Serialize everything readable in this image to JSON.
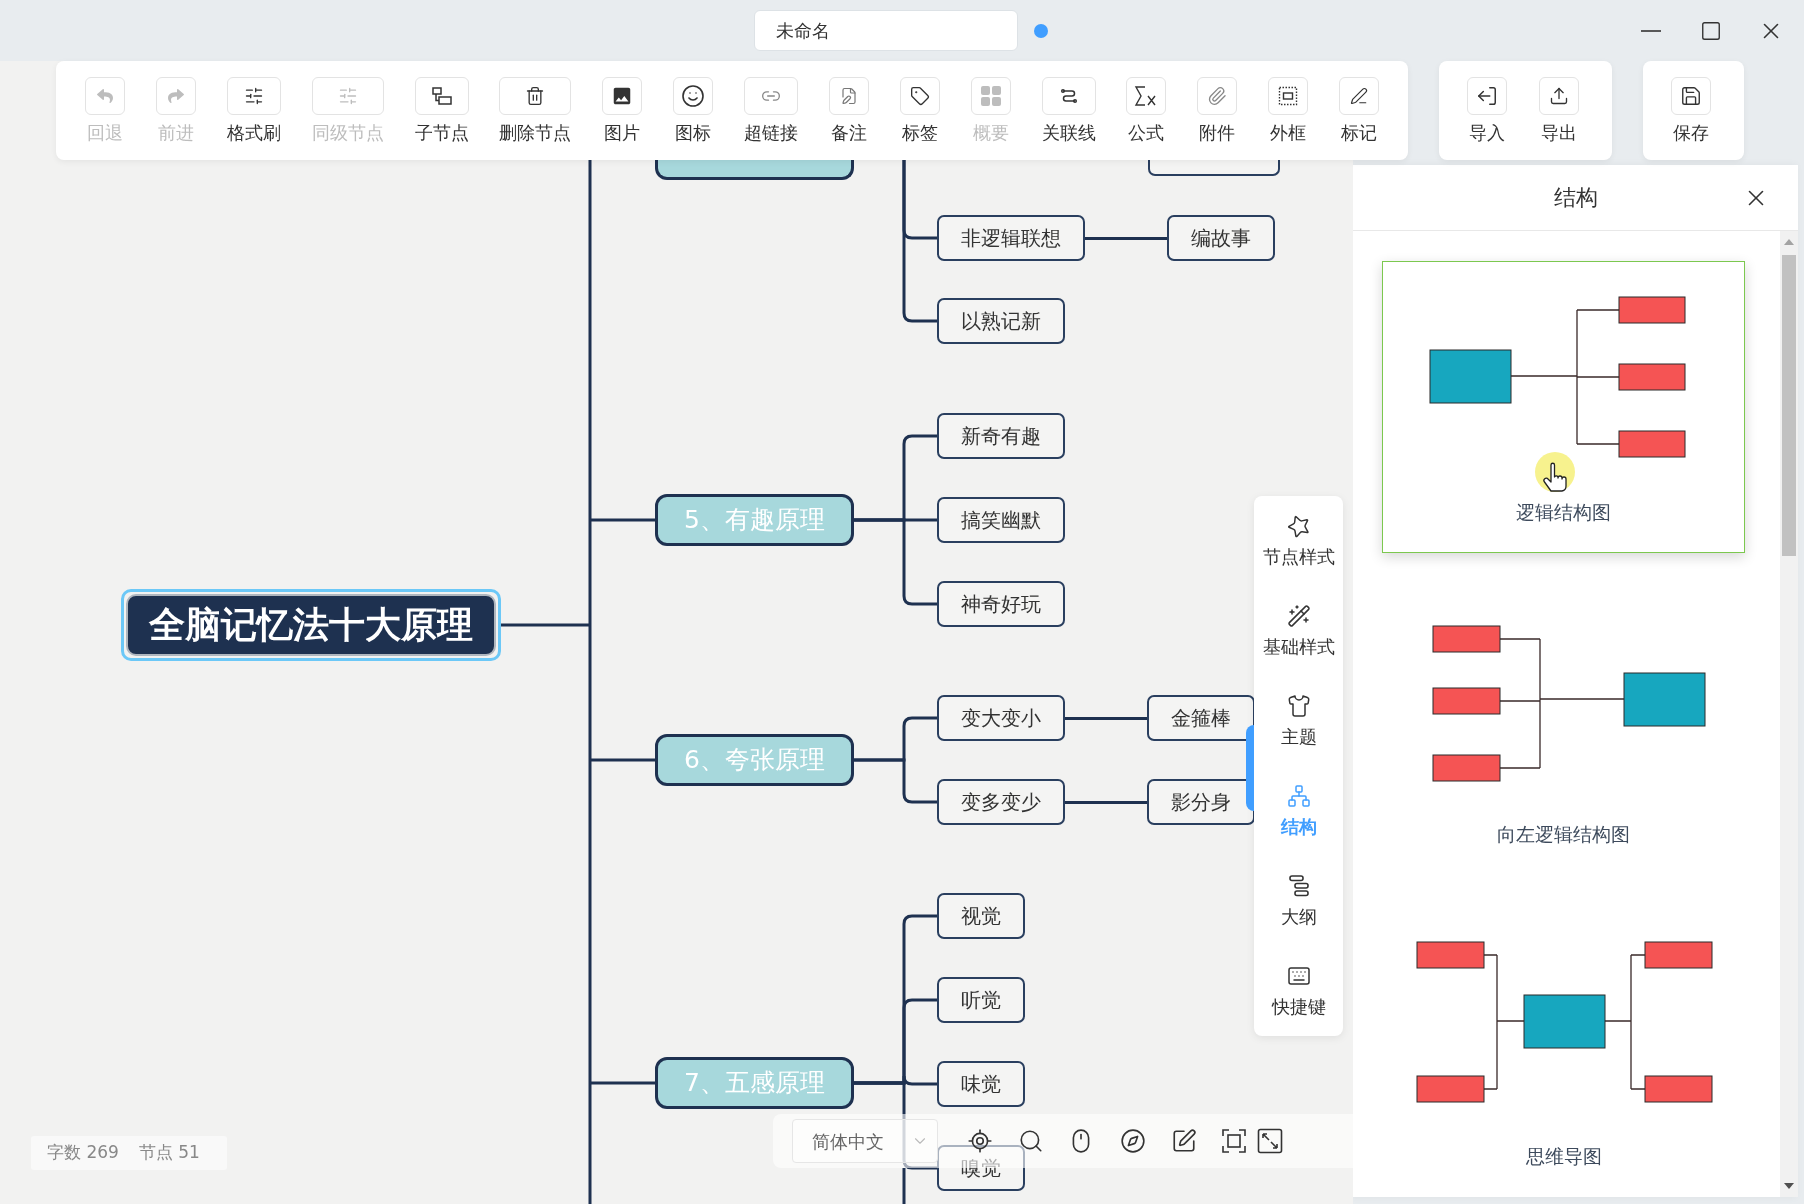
{
  "window": {
    "title": "未命名",
    "modified": true
  },
  "toolbar": {
    "groups": [
      {
        "items": [
          {
            "kind": "undo",
            "label": "回退",
            "disabled": true
          },
          {
            "kind": "redo",
            "label": "前进",
            "disabled": true
          },
          {
            "kind": "format",
            "label": "格式刷",
            "disabled": false
          },
          {
            "kind": "sibling",
            "label": "同级节点",
            "disabled": true
          },
          {
            "kind": "child",
            "label": "子节点",
            "disabled": false
          },
          {
            "kind": "delete",
            "label": "删除节点",
            "disabled": false
          },
          {
            "kind": "image",
            "label": "图片",
            "disabled": false
          },
          {
            "kind": "icon",
            "label": "图标",
            "disabled": false
          },
          {
            "kind": "link",
            "label": "超链接",
            "disabled": false
          },
          {
            "kind": "note",
            "label": "备注",
            "disabled": false
          },
          {
            "kind": "tag",
            "label": "标签",
            "disabled": false
          },
          {
            "kind": "summary",
            "label": "概要",
            "disabled": true
          },
          {
            "kind": "relation",
            "label": "关联线",
            "disabled": false
          },
          {
            "kind": "formula",
            "label": "公式",
            "disabled": false
          },
          {
            "kind": "attachment",
            "label": "附件",
            "disabled": false
          },
          {
            "kind": "frame",
            "label": "外框",
            "disabled": false
          },
          {
            "kind": "mark",
            "label": "标记",
            "disabled": false
          }
        ]
      },
      {
        "items": [
          {
            "kind": "import",
            "label": "导入",
            "disabled": false
          },
          {
            "kind": "export",
            "label": "导出",
            "disabled": false
          }
        ]
      },
      {
        "items": [
          {
            "kind": "save",
            "label": "保存",
            "disabled": false
          }
        ]
      }
    ]
  },
  "mind_map": {
    "root": {
      "label": "全脑记忆法十大原理",
      "selected": true,
      "children": [
        {
          "selected": false,
          "children": [
            {
              "children": [
                {
                  "selected": false
                }
              ]
            },
            {
              "label": "非逻辑联想",
              "selected": false,
              "children": [
                {
                  "label": "编故事",
                  "selected": false
                }
              ]
            },
            {
              "label": "以熟记新",
              "selected": false
            }
          ]
        },
        {
          "label": "5、有趣原理",
          "selected": false,
          "children": [
            {
              "label": "新奇有趣",
              "selected": false
            },
            {
              "label": "搞笑幽默",
              "selected": false
            },
            {
              "label": "神奇好玩",
              "selected": false
            }
          ]
        },
        {
          "label": "6、夸张原理",
          "selected": false,
          "children": [
            {
              "label": "变大变小",
              "selected": false,
              "children": [
                {
                  "label": "金箍棒",
                  "selected": false
                }
              ]
            },
            {
              "label": "变多变少",
              "selected": false,
              "children": [
                {
                  "label": "影分身",
                  "selected": false
                }
              ]
            }
          ]
        },
        {
          "label": "7、五感原理",
          "selected": false,
          "children": [
            {
              "label": "视觉",
              "selected": false
            },
            {
              "label": "听觉",
              "selected": false
            },
            {
              "label": "味觉",
              "selected": false
            },
            {
              "label": "嗅觉",
              "selected": false
            }
          ]
        }
      ]
    }
  },
  "tool_panel": {
    "items": [
      {
        "kind": "node_style",
        "label": "节点样式",
        "selected": false
      },
      {
        "kind": "base_style",
        "label": "基础样式",
        "selected": false
      },
      {
        "kind": "theme",
        "label": "主题",
        "selected": false
      },
      {
        "kind": "structure",
        "label": "结构",
        "selected": true
      },
      {
        "kind": "outline",
        "label": "大纲",
        "selected": false
      },
      {
        "kind": "shortcuts",
        "label": "快捷键",
        "selected": false
      }
    ]
  },
  "view_bar": {
    "language": "简体中文"
  },
  "status_bar": [
    {
      "label": "字数",
      "value": "269"
    },
    {
      "label": "节点",
      "value": "51"
    }
  ],
  "structure_panel": {
    "title": "结构",
    "options": [
      {
        "kind": "logical",
        "label": "逻辑结构图",
        "selected": true
      },
      {
        "kind": "left_logical",
        "label": "向左逻辑结构图",
        "selected": false
      },
      {
        "kind": "mind_map",
        "label": "思维导图",
        "selected": false
      }
    ]
  }
}
